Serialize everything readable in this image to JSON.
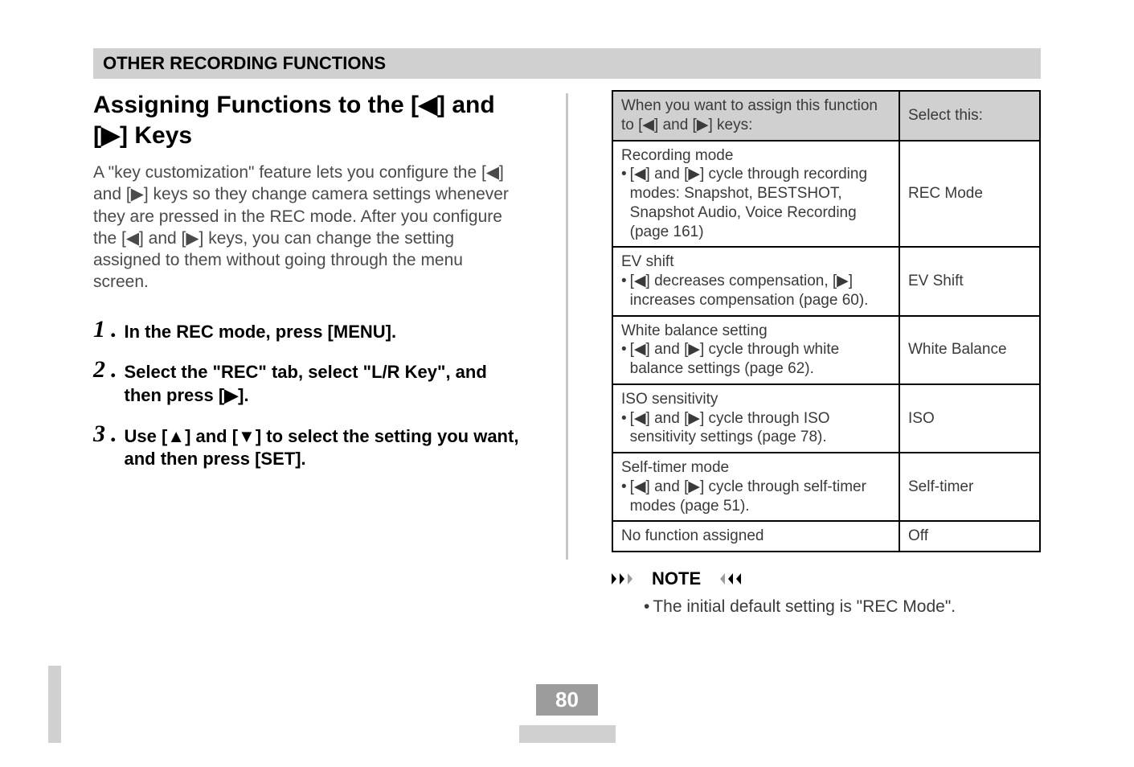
{
  "section_header": "OTHER RECORDING FUNCTIONS",
  "title": "Assigning Functions to the [◀] and [▶] Keys",
  "intro": "A \"key customization\" feature lets you configure the [◀] and [▶] keys so they change camera settings whenever they are pressed in the REC mode. After you configure the [◀] and [▶] keys, you can change the setting assigned to them without going through the menu screen.",
  "steps": [
    {
      "num": "1",
      "text": "In the REC mode, press [MENU]."
    },
    {
      "num": "2",
      "text": "Select the \"REC\" tab, select \"L/R Key\", and then press [▶]."
    },
    {
      "num": "3",
      "text": "Use [▲] and [▼] to select the setting you want, and then press [SET]."
    }
  ],
  "table": {
    "header_left": "When you want to assign this function to [◀] and [▶] keys:",
    "header_right": "Select this:",
    "rows": [
      {
        "title": "Recording mode",
        "bullet": "[◀] and [▶] cycle through recording modes: Snapshot, BESTSHOT, Snapshot Audio, Voice Recording (page 161)",
        "option": "REC Mode"
      },
      {
        "title": "EV shift",
        "bullet": "[◀] decreases compensation, [▶] increases compensation (page 60).",
        "option": "EV Shift"
      },
      {
        "title": "White balance setting",
        "bullet": "[◀] and [▶] cycle through white balance settings (page 62).",
        "option": "White Balance"
      },
      {
        "title": "ISO sensitivity",
        "bullet": "[◀] and [▶] cycle through ISO sensitivity settings (page 78).",
        "option": "ISO"
      },
      {
        "title": "Self-timer mode",
        "bullet": "[◀] and [▶] cycle through self-timer modes (page 51).",
        "option": "Self-timer"
      },
      {
        "title": "No function assigned",
        "bullet": "",
        "option": "Off"
      }
    ]
  },
  "note_label": "NOTE",
  "note_text": "The initial default setting is \"REC Mode\".",
  "page_number": "80"
}
